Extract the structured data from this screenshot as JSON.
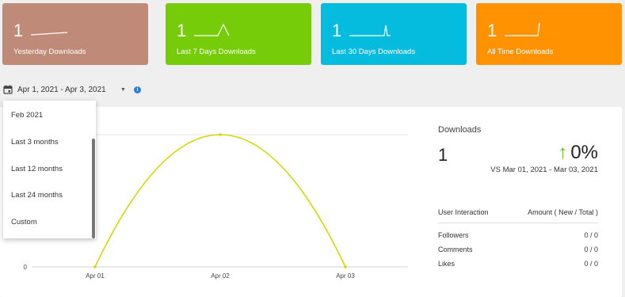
{
  "cards": [
    {
      "value": "1",
      "label": "Yesterday Downloads",
      "color": "#c08a78"
    },
    {
      "value": "1",
      "label": "Last 7 Days Downloads",
      "color": "#77cc0a"
    },
    {
      "value": "1",
      "label": "Last 30 Days Downloads",
      "color": "#06bcde"
    },
    {
      "value": "1",
      "label": "All Time Downloads",
      "color": "#ff9200"
    }
  ],
  "date_range": {
    "value": "Apr 1, 2021 - Apr 3, 2021"
  },
  "dropdown": {
    "options": [
      "Feb 2021",
      "Last 3 months",
      "Last 12 months",
      "Last 24 months",
      "Custom"
    ]
  },
  "chart_data": {
    "type": "line",
    "categories": [
      "Apr 01",
      "Apr 02",
      "Apr 03"
    ],
    "series": [
      {
        "values": [
          0,
          1,
          0
        ],
        "color": "#d6d600"
      }
    ],
    "y_ticks": [
      "0"
    ],
    "ylim": [
      0,
      1
    ]
  },
  "stats": {
    "title": "Downloads",
    "total": "1",
    "change": "0%",
    "change_direction": "up",
    "compare": "VS Mar 01, 2021 - Mar 03, 2021",
    "table_header": {
      "left": "User Interaction",
      "right": "Amount ( New / Total )"
    },
    "rows": [
      {
        "label": "Followers",
        "value": "0 / 0"
      },
      {
        "label": "Comments",
        "value": "0 / 0"
      },
      {
        "label": "Likes",
        "value": "0 / 0"
      }
    ]
  }
}
